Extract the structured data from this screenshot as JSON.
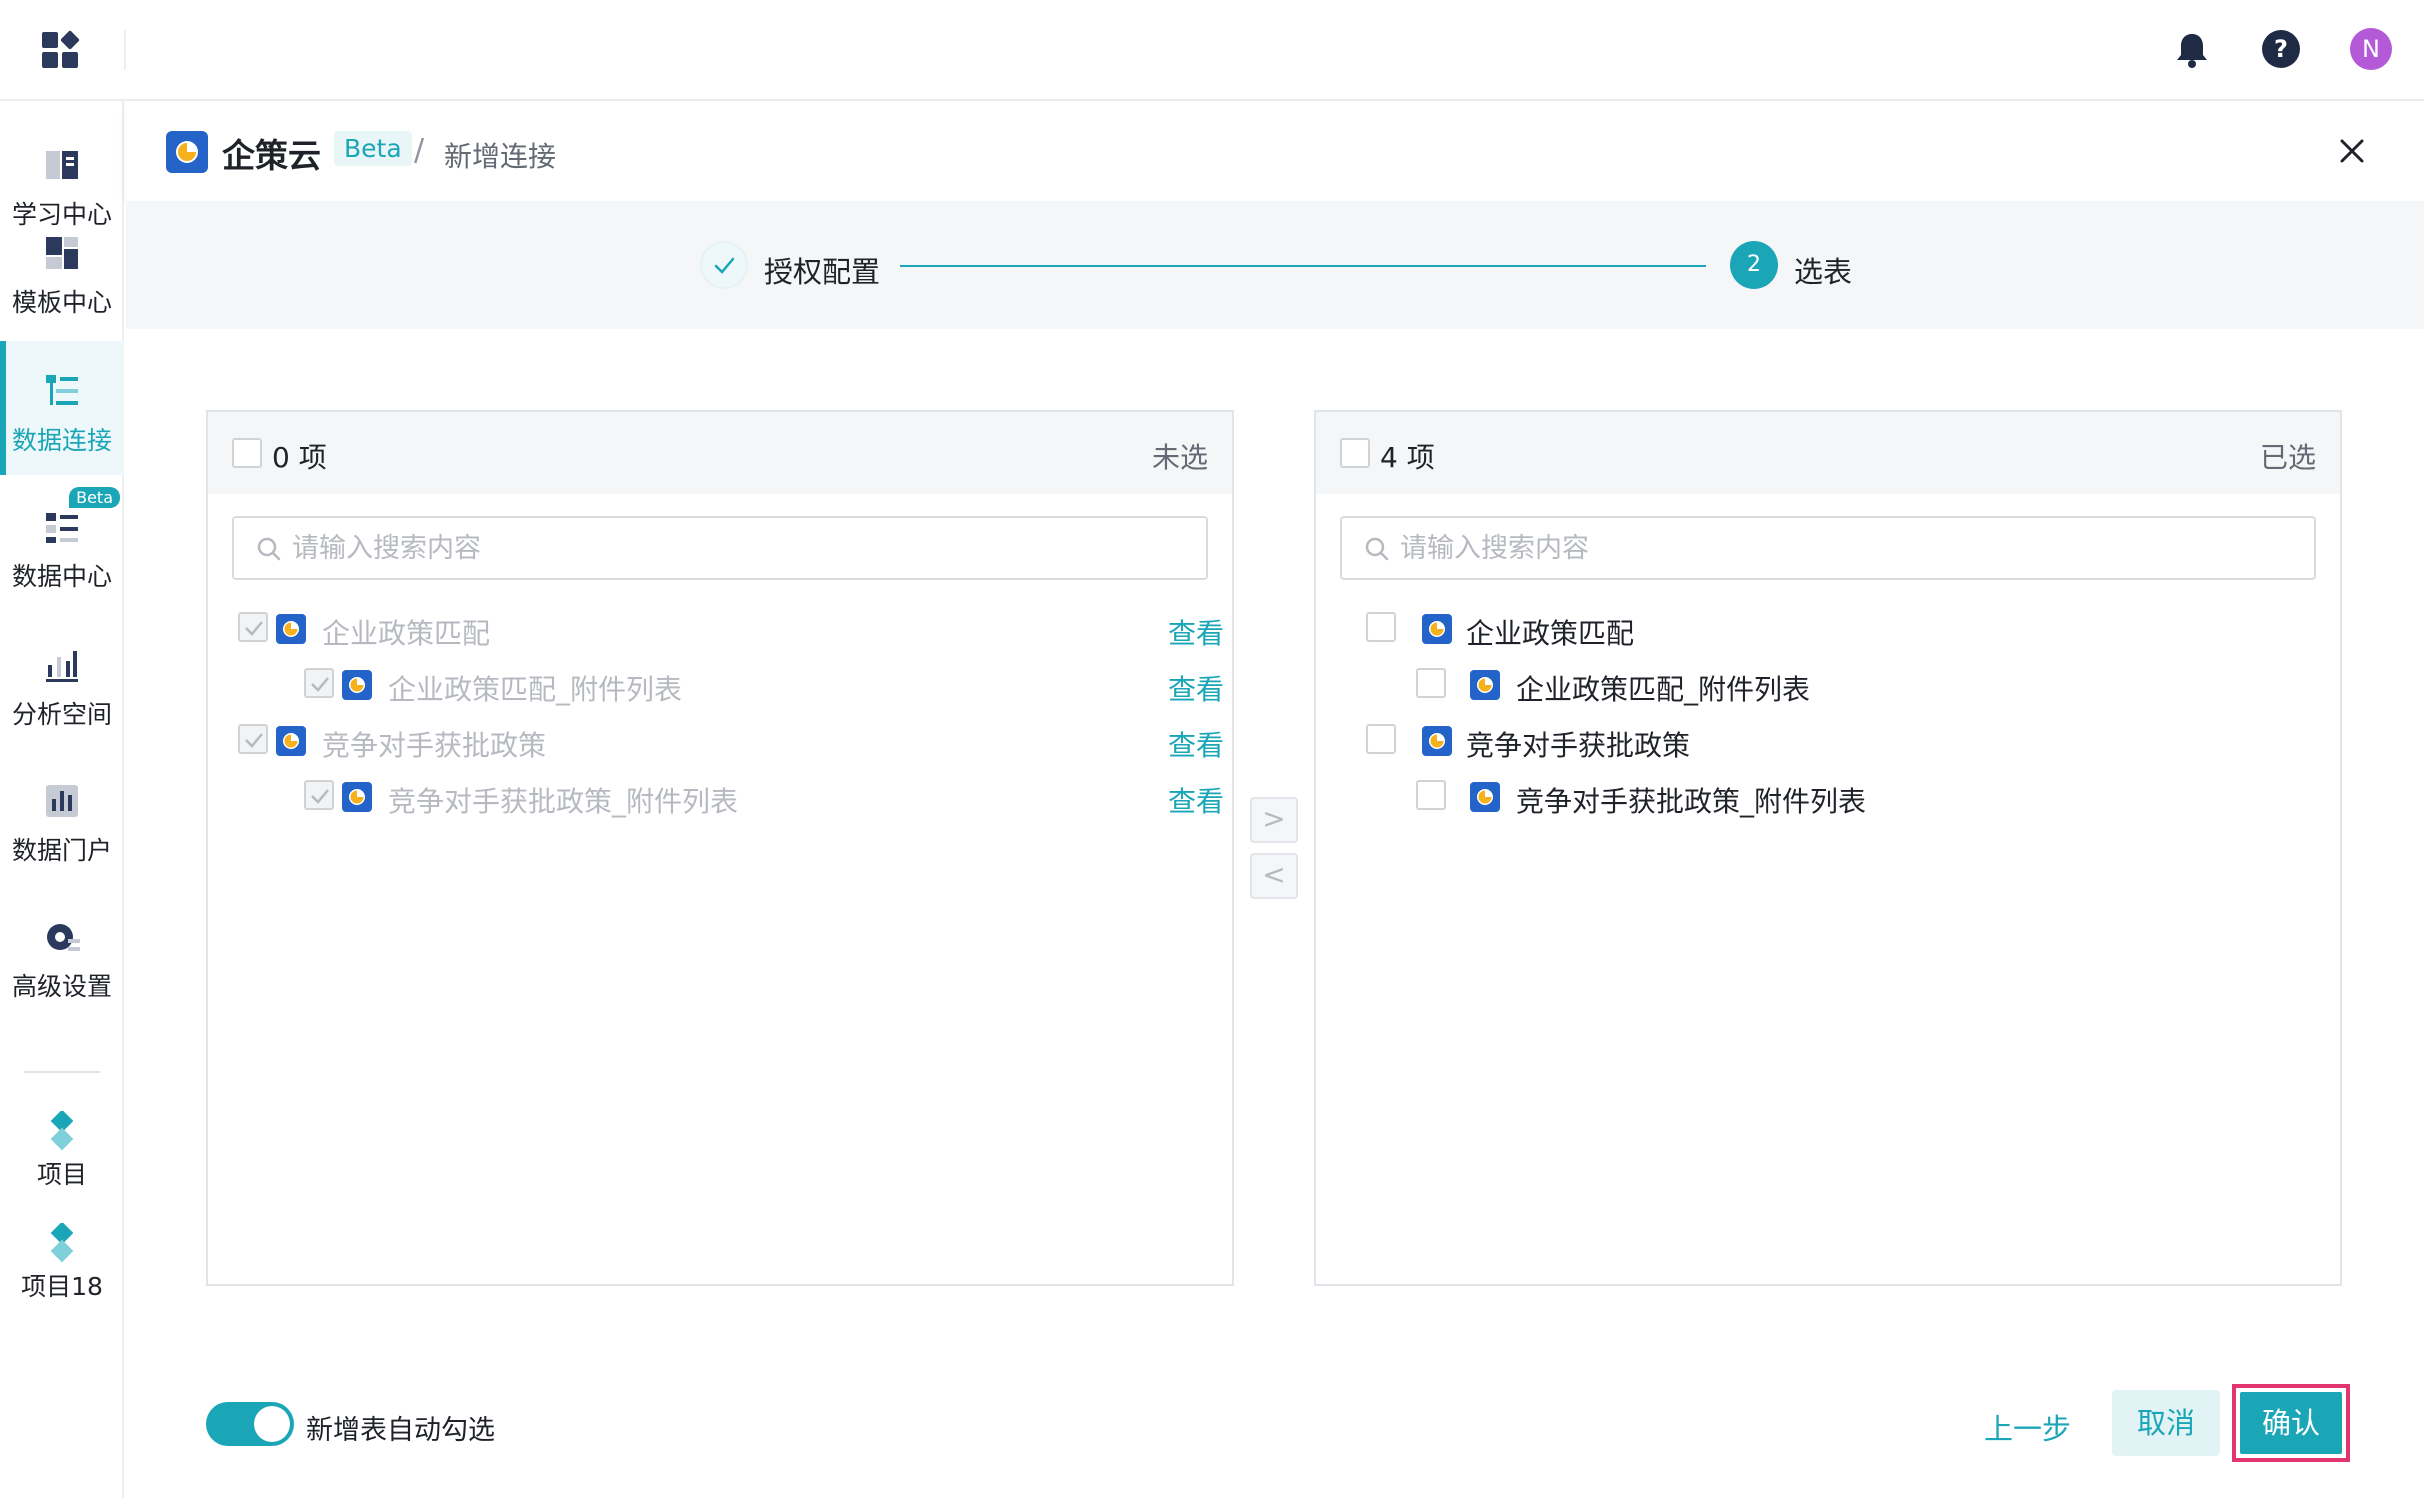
{
  "user": {
    "avatar_initial": "N"
  },
  "sidebar": {
    "items": [
      {
        "label": "学习中心",
        "icon": "book-icon"
      },
      {
        "label": "模板中心",
        "icon": "template-icon"
      },
      {
        "label": "数据连接",
        "icon": "data-connect-icon",
        "active": true
      },
      {
        "label": "数据中心",
        "icon": "data-center-icon",
        "badge": "Beta"
      },
      {
        "label": "分析空间",
        "icon": "analysis-icon"
      },
      {
        "label": "数据门户",
        "icon": "portal-icon"
      },
      {
        "label": "高级设置",
        "icon": "settings-icon"
      }
    ],
    "projects": [
      {
        "label": "项目",
        "icon": "project-icon"
      },
      {
        "label": "项目18",
        "icon": "project-icon"
      }
    ]
  },
  "header": {
    "brand": "企策云",
    "beta": "Beta",
    "separator": "/",
    "page": "新增连接"
  },
  "steps": {
    "step1": {
      "label": "授权配置",
      "status": "done"
    },
    "step2": {
      "label": "选表",
      "number": "2",
      "status": "current"
    }
  },
  "left_panel": {
    "count": "0 项",
    "status": "未选",
    "search_placeholder": "请输入搜索内容",
    "view_label": "查看",
    "rows": [
      {
        "name": "企业政策匹配",
        "level": 0
      },
      {
        "name": "企业政策匹配_附件列表",
        "level": 1
      },
      {
        "name": "竞争对手获批政策",
        "level": 0
      },
      {
        "name": "竞争对手获批政策_附件列表",
        "level": 1
      }
    ]
  },
  "right_panel": {
    "count": "4 项",
    "status": "已选",
    "search_placeholder": "请输入搜索内容",
    "rows": [
      {
        "name": "企业政策匹配",
        "level": 0
      },
      {
        "name": "企业政策匹配_附件列表",
        "level": 1
      },
      {
        "name": "竞争对手获批政策",
        "level": 0
      },
      {
        "name": "竞争对手获批政策_附件列表",
        "level": 1
      }
    ]
  },
  "transfer": {
    "right_arrow": ">",
    "left_arrow": "<"
  },
  "footer": {
    "auto_select_label": "新增表自动勾选",
    "auto_select_on": true,
    "prev_label": "上一步",
    "cancel_label": "取消",
    "confirm_label": "确认"
  },
  "colors": {
    "accent": "#1aa6b7",
    "highlight_border": "#e0356e",
    "avatar": "#b45ad8"
  }
}
